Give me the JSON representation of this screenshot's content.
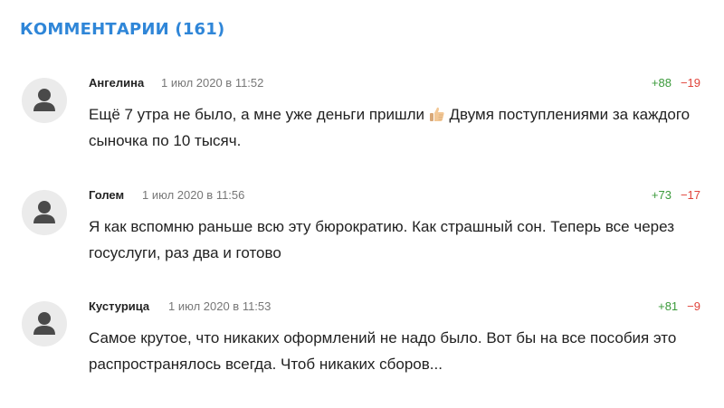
{
  "section": {
    "title": "КОММЕНТАРИИ (161)"
  },
  "colors": {
    "accent": "#2f86d8",
    "plus": "#3a9a3a",
    "minus": "#e0433a",
    "avatar_bg": "#ebebeb"
  },
  "comments": [
    {
      "author": "Ангелина",
      "date": "1 июл 2020 в 11:52",
      "plus": "+88",
      "minus": "−19",
      "text_part1": "Ещё 7 утра не было, а мне уже деньги пришли",
      "emoji": "thumbs-up-icon",
      "text_part2": "Двумя поступлениями за каждого сыночка по 10 тысяч."
    },
    {
      "author": "Голем",
      "date": "1 июл 2020 в 11:56",
      "plus": "+73",
      "minus": "−17",
      "text": "Я как вспомню раньше всю эту бюрократию. Как страшный сон. Теперь все через госуслуги, раз два и готово"
    },
    {
      "author": "Кустурица",
      "date": "1 июл 2020 в 11:53",
      "plus": "+81",
      "minus": "−9",
      "text": "Самое крутое, что никаких оформлений не надо было. Вот бы на все пособия это распространялось всегда. Чтоб никаких сборов..."
    }
  ]
}
